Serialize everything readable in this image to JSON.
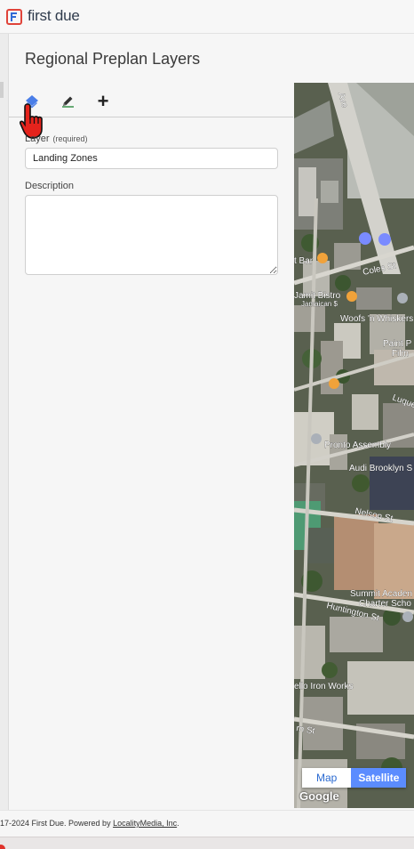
{
  "app": {
    "brand": "first due"
  },
  "page": {
    "title": "Regional Preplan Layers"
  },
  "toolbar": {
    "tools": [
      "layers-icon",
      "pencil-icon",
      "plus-icon"
    ],
    "add_glyph": "+"
  },
  "form": {
    "layer_label": "Layer",
    "layer_required": "(required)",
    "layer_value": "Landing Zones",
    "description_label": "Description",
    "description_value": ""
  },
  "map": {
    "street_labels": [
      "Ave",
      "Coles St",
      "Nelson St",
      "Luque",
      "Huntington St",
      "rn St"
    ],
    "place_labels": [
      "Jamit Bistro",
      "Jamaican $",
      "Woofs 'n Whiskers",
      "Paint P",
      "Film",
      "Pronto Assembly",
      "Audi Brooklyn S",
      "Summit Acaden",
      "Charter Scho",
      "ello Iron Works",
      "t Bar"
    ],
    "map_type_options": [
      "Map",
      "Satellite"
    ],
    "map_type_selected": "Satellite",
    "attribution": "Google"
  },
  "footer": {
    "text": "17-2024 First Due. Powered by ",
    "link": "LocalityMedia, Inc",
    "suffix": "."
  },
  "colors": {
    "accent": "#5b8cff",
    "brand": "#2f3b4c",
    "layers_icon": "#4a7ee8",
    "hand": "#e5231c"
  }
}
